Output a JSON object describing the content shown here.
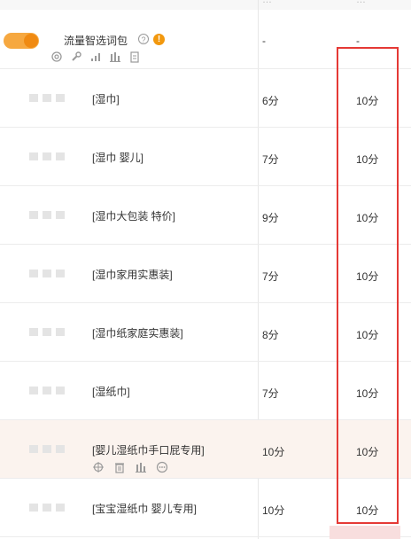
{
  "package": {
    "title": "流量智选词包",
    "help_glyph": "?",
    "info_glyph": "!",
    "col_a": "-",
    "col_b": "-",
    "toggle_on": true
  },
  "keywords": [
    {
      "keyword": "[湿巾]",
      "score_a": "6分",
      "score_b": "10分"
    },
    {
      "keyword": "[湿巾 婴儿]",
      "score_a": "7分",
      "score_b": "10分"
    },
    {
      "keyword": "[湿巾大包装 特价]",
      "score_a": "9分",
      "score_b": "10分"
    },
    {
      "keyword": "[湿巾家用实惠装]",
      "score_a": "7分",
      "score_b": "10分"
    },
    {
      "keyword": "[湿巾纸家庭实惠装]",
      "score_a": "8分",
      "score_b": "10分"
    },
    {
      "keyword": "[湿纸巾]",
      "score_a": "7分",
      "score_b": "10分"
    },
    {
      "keyword": "[婴儿湿纸巾手口屁专用]",
      "score_a": "10分",
      "score_b": "10分"
    },
    {
      "keyword": "[宝宝湿纸巾 婴儿专用]",
      "score_a": "10分",
      "score_b": "10分"
    }
  ],
  "colors": {
    "accent": "#f08a12",
    "highlight_row": "#fbf3ee",
    "annotation": "#e53935"
  }
}
